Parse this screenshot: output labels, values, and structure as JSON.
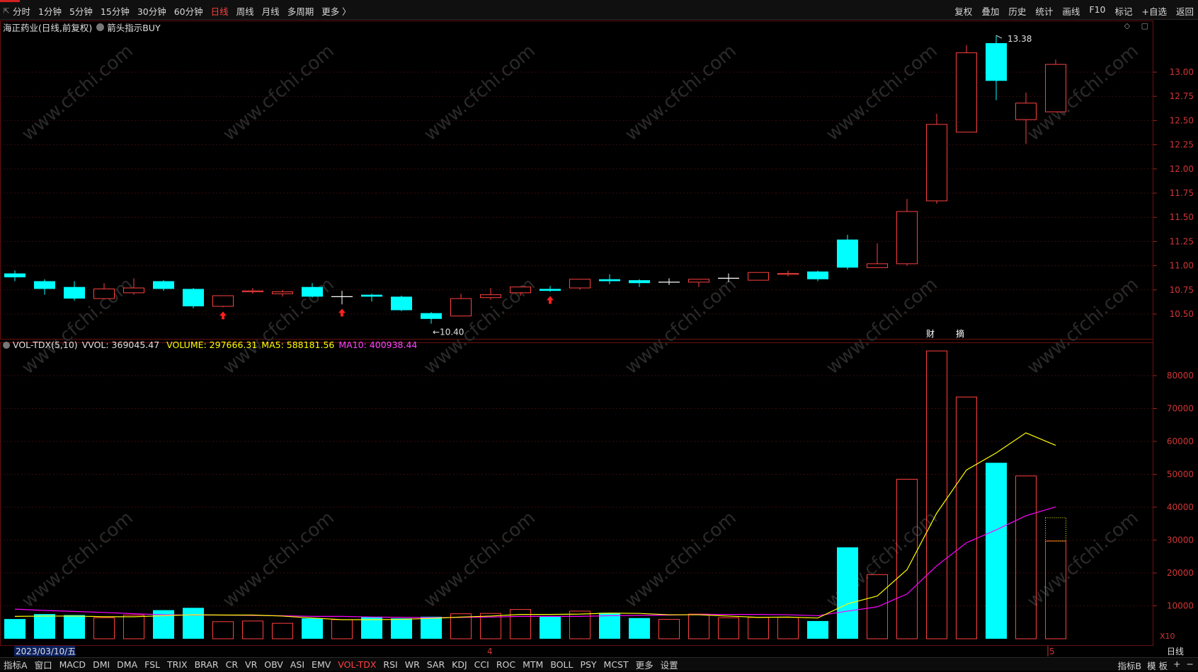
{
  "toolbar": {
    "left_icon": "⇱",
    "periods": [
      "分时",
      "1分钟",
      "5分钟",
      "15分钟",
      "30分钟",
      "60分钟",
      "日线",
      "周线",
      "月线",
      "多周期",
      "更多 〉"
    ],
    "active_period": "日线",
    "right_items": [
      "复权",
      "叠加",
      "历史",
      "统计",
      "画线",
      "F10",
      "标记",
      "+自选",
      "返回"
    ]
  },
  "main_chart": {
    "title": "海正药业(日线,前复权)",
    "indicator": "箭头指示BUY",
    "top_icons": "◇ ▢",
    "y_ticks": [
      "13.00",
      "12.75",
      "12.50",
      "12.25",
      "12.00",
      "11.75",
      "11.50",
      "11.25",
      "11.00",
      "10.75",
      "10.50"
    ],
    "high_label": "13.38",
    "low_label": "10.40",
    "events": [
      "财",
      "摘"
    ]
  },
  "volume_chart": {
    "title": "VOL-TDX(5,10)",
    "vvol": "VVOL: 369045.47",
    "volume": "VOLUME: 297666.31",
    "ma5": "MA5: 588181.56",
    "ma10": "MA10: 400938.44",
    "y_ticks": [
      "80000",
      "70000",
      "60000",
      "50000",
      "40000",
      "30000",
      "20000",
      "10000"
    ],
    "unit": "X10",
    "colors": {
      "volume": "#ffff00",
      "ma5": "#ffff00",
      "ma10": "#ff00ff"
    }
  },
  "chart_data": {
    "type": "candlestick",
    "candles": [
      {
        "o": 10.92,
        "c": 10.88,
        "h": 10.95,
        "l": 10.84
      },
      {
        "o": 10.84,
        "c": 10.76,
        "h": 10.86,
        "l": 10.7
      },
      {
        "o": 10.78,
        "c": 10.66,
        "h": 10.84,
        "l": 10.64
      },
      {
        "o": 10.66,
        "c": 10.76,
        "h": 10.82,
        "l": 10.66
      },
      {
        "o": 10.72,
        "c": 10.77,
        "h": 10.87,
        "l": 10.7
      },
      {
        "o": 10.84,
        "c": 10.76,
        "h": 10.85,
        "l": 10.74
      },
      {
        "o": 10.76,
        "c": 10.58,
        "h": 10.77,
        "l": 10.56
      },
      {
        "o": 10.58,
        "c": 10.69,
        "h": 10.69,
        "l": 10.57
      },
      {
        "o": 10.73,
        "c": 10.74,
        "h": 10.77,
        "l": 10.71
      },
      {
        "o": 10.71,
        "c": 10.73,
        "h": 10.75,
        "l": 10.68
      },
      {
        "o": 10.78,
        "c": 10.68,
        "h": 10.82,
        "l": 10.67
      },
      {
        "o": 10.68,
        "c": 10.68,
        "h": 10.74,
        "l": 10.6
      },
      {
        "o": 10.7,
        "c": 10.68,
        "h": 10.71,
        "l": 10.63
      },
      {
        "o": 10.68,
        "c": 10.54,
        "h": 10.69,
        "l": 10.53
      },
      {
        "o": 10.51,
        "c": 10.45,
        "h": 10.52,
        "l": 10.4
      },
      {
        "o": 10.48,
        "c": 10.66,
        "h": 10.71,
        "l": 10.48
      },
      {
        "o": 10.67,
        "c": 10.7,
        "h": 10.77,
        "l": 10.65
      },
      {
        "o": 10.72,
        "c": 10.78,
        "h": 10.78,
        "l": 10.69
      },
      {
        "o": 10.76,
        "c": 10.74,
        "h": 10.79,
        "l": 10.73
      },
      {
        "o": 10.77,
        "c": 10.86,
        "h": 10.86,
        "l": 10.75
      },
      {
        "o": 10.86,
        "c": 10.84,
        "h": 10.91,
        "l": 10.81
      },
      {
        "o": 10.85,
        "c": 10.82,
        "h": 10.86,
        "l": 10.78
      },
      {
        "o": 10.83,
        "c": 10.83,
        "h": 10.87,
        "l": 10.8
      },
      {
        "o": 10.83,
        "c": 10.86,
        "h": 10.86,
        "l": 10.78
      },
      {
        "o": 10.87,
        "c": 10.87,
        "h": 10.92,
        "l": 10.83
      },
      {
        "o": 10.85,
        "c": 10.93,
        "h": 10.93,
        "l": 10.85
      },
      {
        "o": 10.91,
        "c": 10.92,
        "h": 10.95,
        "l": 10.89
      },
      {
        "o": 10.94,
        "c": 10.86,
        "h": 10.95,
        "l": 10.84
      },
      {
        "o": 11.27,
        "c": 10.98,
        "h": 11.32,
        "l": 10.96
      },
      {
        "o": 10.98,
        "c": 11.02,
        "h": 11.23,
        "l": 10.98
      },
      {
        "o": 11.02,
        "c": 11.56,
        "h": 11.69,
        "l": 11.0
      },
      {
        "o": 11.67,
        "c": 12.46,
        "h": 12.57,
        "l": 11.64
      },
      {
        "o": 12.38,
        "c": 13.2,
        "h": 13.28,
        "l": 12.38
      },
      {
        "o": 13.3,
        "c": 12.91,
        "h": 13.38,
        "l": 12.71
      },
      {
        "o": 12.51,
        "c": 12.68,
        "h": 12.79,
        "l": 12.26
      },
      {
        "o": 12.59,
        "c": 13.08,
        "h": 13.13,
        "l": 12.59
      }
    ],
    "volumes": [
      6000,
      7500,
      7200,
      6400,
      7200,
      8700,
      9400,
      5200,
      5400,
      4700,
      6200,
      5800,
      6700,
      6200,
      6700,
      7600,
      7700,
      8900,
      6800,
      8400,
      7900,
      6300,
      5900,
      7500,
      6400,
      6500,
      6500,
      5400,
      27800,
      19500,
      48500,
      87500,
      73500,
      53500,
      49500,
      29700
    ],
    "ma5": [
      6800,
      6900,
      6900,
      6700,
      6700,
      7000,
      7300,
      7200,
      7200,
      6900,
      6300,
      5800,
      5800,
      5900,
      6200,
      6600,
      6900,
      7400,
      7400,
      7500,
      7800,
      7700,
      7300,
      7300,
      6900,
      6500,
      6600,
      6300,
      10600,
      13000,
      21000,
      38200,
      51300,
      56500,
      62600,
      58800
    ],
    "ma10": [
      9000,
      8600,
      8300,
      8000,
      7600,
      7300,
      7200,
      7200,
      7100,
      7000,
      6800,
      6800,
      6600,
      6500,
      6400,
      6500,
      6600,
      6800,
      6800,
      6800,
      7000,
      7100,
      7200,
      7400,
      7400,
      7400,
      7300,
      7000,
      8400,
      9700,
      13600,
      22200,
      29200,
      33100,
      37400,
      40100
    ],
    "ylim_price": [
      10.4,
      13.38
    ],
    "ylim_volume": [
      0,
      88000
    ],
    "x_labels": [
      "2023/03/10/五",
      "4",
      "5"
    ],
    "buy_arrows": [
      7,
      11,
      18
    ]
  },
  "bottombar": {
    "items": [
      "指标A",
      "窗口",
      "MACD",
      "DMI",
      "DMA",
      "FSL",
      "TRIX",
      "BRAR",
      "CR",
      "VR",
      "OBV",
      "ASI",
      "EMV",
      "VOL-TDX",
      "RSI",
      "WR",
      "SAR",
      "KDJ",
      "CCI",
      "ROC",
      "MTM",
      "BOLL",
      "PSY",
      "MCST",
      "更多",
      "设置"
    ],
    "active": "VOL-TDX",
    "right_items": [
      "指标B",
      "模 板",
      "+",
      "−"
    ],
    "right_period": "日线"
  },
  "watermark": "www.cfchi.com"
}
